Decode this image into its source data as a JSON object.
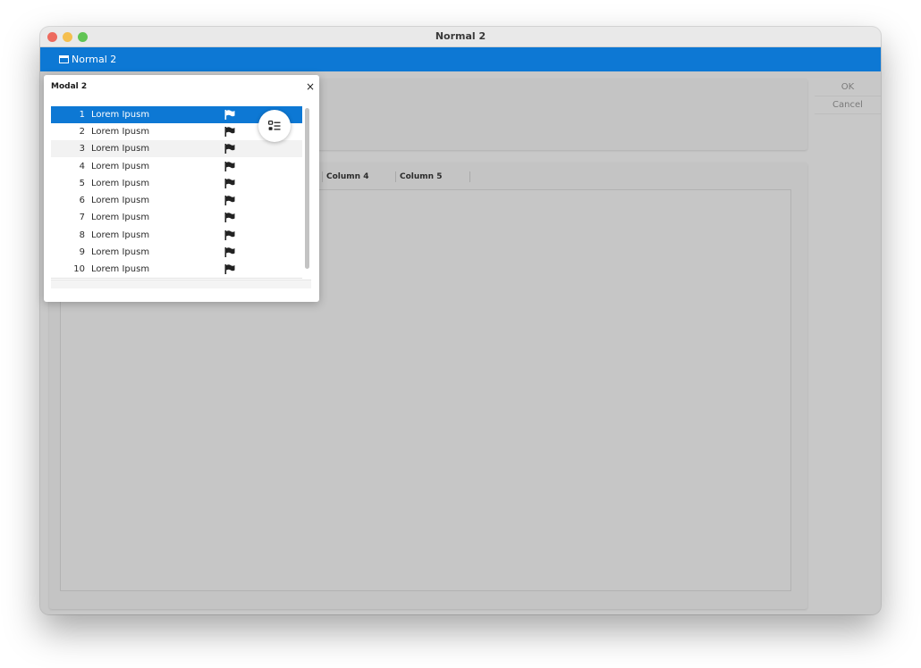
{
  "window": {
    "title": "Normal 2"
  },
  "tabs": [
    {
      "label": "Normal 2",
      "icon": "window-icon"
    }
  ],
  "side_buttons": {
    "ok_label": "OK",
    "cancel_label": "Cancel"
  },
  "table": {
    "columns": [
      "Column 4",
      "Column 5"
    ]
  },
  "modal": {
    "title": "Modal 2",
    "close_glyph": "×",
    "rows": [
      {
        "num": "1",
        "text": "Lorem Ipusm",
        "icon": "flag-icon",
        "selected": true
      },
      {
        "num": "2",
        "text": "Lorem Ipusm",
        "icon": "flag-icon"
      },
      {
        "num": "3",
        "text": "Lorem Ipusm",
        "icon": "flag-icon"
      },
      {
        "num": "4",
        "text": "Lorem Ipusm",
        "icon": "flag-icon"
      },
      {
        "num": "5",
        "text": "Lorem Ipusm",
        "icon": "flag-icon"
      },
      {
        "num": "6",
        "text": "Lorem Ipusm",
        "icon": "flag-icon"
      },
      {
        "num": "7",
        "text": "Lorem Ipusm",
        "icon": "flag-icon"
      },
      {
        "num": "8",
        "text": "Lorem Ipusm",
        "icon": "flag-icon"
      },
      {
        "num": "9",
        "text": "Lorem Ipusm",
        "icon": "flag-icon"
      },
      {
        "num": "10",
        "text": "Lorem Ipusm",
        "icon": "flag-icon"
      }
    ],
    "fab_icon": "list-view-icon"
  },
  "colors": {
    "accent": "#0d78d4",
    "overlay_bg": "#c8c8c8"
  }
}
